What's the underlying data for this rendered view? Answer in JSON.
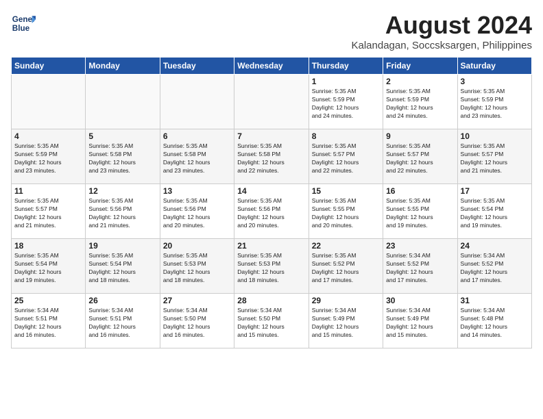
{
  "header": {
    "logo_line1": "General",
    "logo_line2": "Blue",
    "month_year": "August 2024",
    "location": "Kalandagan, Soccsksargen, Philippines"
  },
  "weekdays": [
    "Sunday",
    "Monday",
    "Tuesday",
    "Wednesday",
    "Thursday",
    "Friday",
    "Saturday"
  ],
  "weeks": [
    [
      {
        "day": "",
        "info": ""
      },
      {
        "day": "",
        "info": ""
      },
      {
        "day": "",
        "info": ""
      },
      {
        "day": "",
        "info": ""
      },
      {
        "day": "1",
        "info": "Sunrise: 5:35 AM\nSunset: 5:59 PM\nDaylight: 12 hours\nand 24 minutes."
      },
      {
        "day": "2",
        "info": "Sunrise: 5:35 AM\nSunset: 5:59 PM\nDaylight: 12 hours\nand 24 minutes."
      },
      {
        "day": "3",
        "info": "Sunrise: 5:35 AM\nSunset: 5:59 PM\nDaylight: 12 hours\nand 23 minutes."
      }
    ],
    [
      {
        "day": "4",
        "info": "Sunrise: 5:35 AM\nSunset: 5:59 PM\nDaylight: 12 hours\nand 23 minutes."
      },
      {
        "day": "5",
        "info": "Sunrise: 5:35 AM\nSunset: 5:58 PM\nDaylight: 12 hours\nand 23 minutes."
      },
      {
        "day": "6",
        "info": "Sunrise: 5:35 AM\nSunset: 5:58 PM\nDaylight: 12 hours\nand 23 minutes."
      },
      {
        "day": "7",
        "info": "Sunrise: 5:35 AM\nSunset: 5:58 PM\nDaylight: 12 hours\nand 22 minutes."
      },
      {
        "day": "8",
        "info": "Sunrise: 5:35 AM\nSunset: 5:57 PM\nDaylight: 12 hours\nand 22 minutes."
      },
      {
        "day": "9",
        "info": "Sunrise: 5:35 AM\nSunset: 5:57 PM\nDaylight: 12 hours\nand 22 minutes."
      },
      {
        "day": "10",
        "info": "Sunrise: 5:35 AM\nSunset: 5:57 PM\nDaylight: 12 hours\nand 21 minutes."
      }
    ],
    [
      {
        "day": "11",
        "info": "Sunrise: 5:35 AM\nSunset: 5:57 PM\nDaylight: 12 hours\nand 21 minutes."
      },
      {
        "day": "12",
        "info": "Sunrise: 5:35 AM\nSunset: 5:56 PM\nDaylight: 12 hours\nand 21 minutes."
      },
      {
        "day": "13",
        "info": "Sunrise: 5:35 AM\nSunset: 5:56 PM\nDaylight: 12 hours\nand 20 minutes."
      },
      {
        "day": "14",
        "info": "Sunrise: 5:35 AM\nSunset: 5:56 PM\nDaylight: 12 hours\nand 20 minutes."
      },
      {
        "day": "15",
        "info": "Sunrise: 5:35 AM\nSunset: 5:55 PM\nDaylight: 12 hours\nand 20 minutes."
      },
      {
        "day": "16",
        "info": "Sunrise: 5:35 AM\nSunset: 5:55 PM\nDaylight: 12 hours\nand 19 minutes."
      },
      {
        "day": "17",
        "info": "Sunrise: 5:35 AM\nSunset: 5:54 PM\nDaylight: 12 hours\nand 19 minutes."
      }
    ],
    [
      {
        "day": "18",
        "info": "Sunrise: 5:35 AM\nSunset: 5:54 PM\nDaylight: 12 hours\nand 19 minutes."
      },
      {
        "day": "19",
        "info": "Sunrise: 5:35 AM\nSunset: 5:54 PM\nDaylight: 12 hours\nand 18 minutes."
      },
      {
        "day": "20",
        "info": "Sunrise: 5:35 AM\nSunset: 5:53 PM\nDaylight: 12 hours\nand 18 minutes."
      },
      {
        "day": "21",
        "info": "Sunrise: 5:35 AM\nSunset: 5:53 PM\nDaylight: 12 hours\nand 18 minutes."
      },
      {
        "day": "22",
        "info": "Sunrise: 5:35 AM\nSunset: 5:52 PM\nDaylight: 12 hours\nand 17 minutes."
      },
      {
        "day": "23",
        "info": "Sunrise: 5:34 AM\nSunset: 5:52 PM\nDaylight: 12 hours\nand 17 minutes."
      },
      {
        "day": "24",
        "info": "Sunrise: 5:34 AM\nSunset: 5:52 PM\nDaylight: 12 hours\nand 17 minutes."
      }
    ],
    [
      {
        "day": "25",
        "info": "Sunrise: 5:34 AM\nSunset: 5:51 PM\nDaylight: 12 hours\nand 16 minutes."
      },
      {
        "day": "26",
        "info": "Sunrise: 5:34 AM\nSunset: 5:51 PM\nDaylight: 12 hours\nand 16 minutes."
      },
      {
        "day": "27",
        "info": "Sunrise: 5:34 AM\nSunset: 5:50 PM\nDaylight: 12 hours\nand 16 minutes."
      },
      {
        "day": "28",
        "info": "Sunrise: 5:34 AM\nSunset: 5:50 PM\nDaylight: 12 hours\nand 15 minutes."
      },
      {
        "day": "29",
        "info": "Sunrise: 5:34 AM\nSunset: 5:49 PM\nDaylight: 12 hours\nand 15 minutes."
      },
      {
        "day": "30",
        "info": "Sunrise: 5:34 AM\nSunset: 5:49 PM\nDaylight: 12 hours\nand 15 minutes."
      },
      {
        "day": "31",
        "info": "Sunrise: 5:34 AM\nSunset: 5:48 PM\nDaylight: 12 hours\nand 14 minutes."
      }
    ]
  ]
}
